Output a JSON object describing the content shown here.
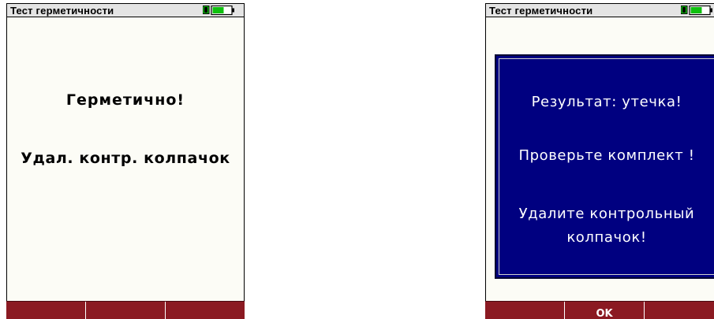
{
  "left_screen": {
    "title": "Тест герметичности",
    "battery_icon": "battery-icon",
    "message_1": "Герметично!",
    "message_2": "Удал. контр. колпачок",
    "softkeys": [
      "",
      "",
      ""
    ]
  },
  "right_screen": {
    "title": "Тест герметичности",
    "battery_icon": "battery-icon",
    "dialog": {
      "line_1": "Результат: утечка!",
      "line_2": "Проверьте комплект !",
      "line_3a": "Удалите контрольный",
      "line_3b": "колпачок!"
    },
    "softkeys": [
      "",
      "OK",
      ""
    ]
  },
  "colors": {
    "dialog_bg": "#000080",
    "softkey_bar": "#8b1a22",
    "battery_green": "#10c010",
    "titlebar_bg": "#e4e4e4"
  }
}
